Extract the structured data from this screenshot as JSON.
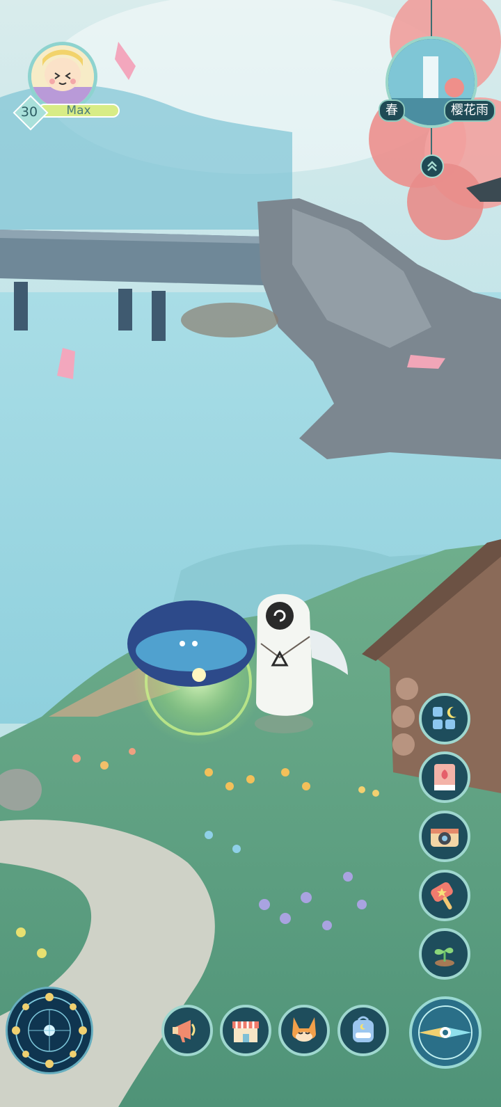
{
  "player": {
    "level": "30",
    "name": "Max",
    "avatar_icon": "girl-avatar-icon"
  },
  "season_widget": {
    "season": "春",
    "weather": "樱花雨",
    "expand_icon": "chevron-up-double-icon"
  },
  "side_menu": [
    {
      "name": "collection-icon"
    },
    {
      "name": "flower-book-icon"
    },
    {
      "name": "camera-icon"
    },
    {
      "name": "star-mallet-icon"
    },
    {
      "name": "sprout-icon"
    }
  ],
  "bottom_bar": [
    {
      "name": "megaphone-icon"
    },
    {
      "name": "shop-icon"
    },
    {
      "name": "fox-pet-icon"
    },
    {
      "name": "backpack-icon"
    }
  ],
  "colors": {
    "accent": "#9fd7cf",
    "button_bg": "#1e4d5c",
    "name_bar": "#d8ec86"
  }
}
